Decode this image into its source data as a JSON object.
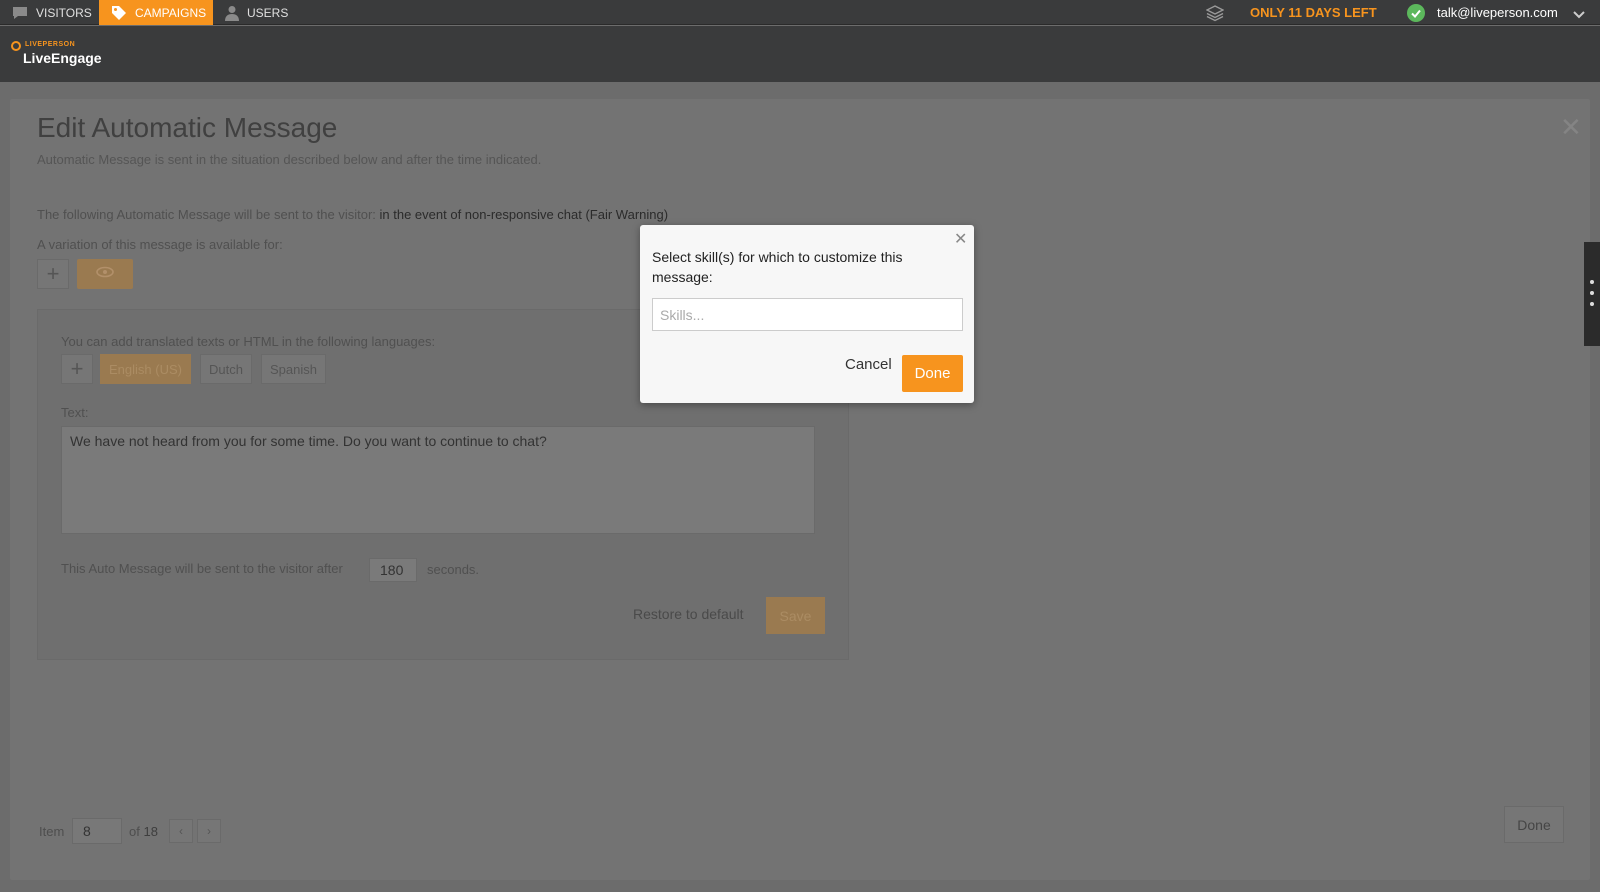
{
  "nav": {
    "tabs": [
      {
        "label": "VISITORS",
        "icon": "chat-bubble-icon"
      },
      {
        "label": "CAMPAIGNS",
        "icon": "tag-icon",
        "active": true
      },
      {
        "label": "USERS",
        "icon": "user-icon"
      }
    ],
    "trial_text": "ONLY 11 DAYS LEFT",
    "user_email": "talk@liveperson.com",
    "accent_color": "#f7941e"
  },
  "header": {
    "logo_small": "LIVEPERSON",
    "logo_big": "LiveEngage"
  },
  "panel": {
    "title": "Edit Automatic Message",
    "subtitle": "Automatic Message is sent in the situation described below and after the time indicated.",
    "following_label": "The following Automatic Message will be sent to the visitor:",
    "following_value": "in the event of non-responsive chat (Fair Warning)",
    "variation_label": "A variation of this message is available for:",
    "languages_label": "You can add translated texts or HTML in the following languages:",
    "languages": [
      "English (US)",
      "Dutch",
      "Spanish"
    ],
    "text_label": "Text:",
    "message_text": "We have not heard from you for some time.  Do you want to continue to chat?",
    "after_label": "This Auto Message will be sent to the visitor after",
    "seconds_value": "180",
    "seconds_label": "seconds.",
    "restore_label": "Restore to default",
    "save_label": "Save",
    "item_label": "Item",
    "item_value": "8",
    "of_label": "of",
    "total": "18",
    "done_label": "Done"
  },
  "modal": {
    "title": "Select skill(s) for which to customize this message:",
    "skills_placeholder": "Skills...",
    "cancel_label": "Cancel",
    "done_label": "Done"
  }
}
